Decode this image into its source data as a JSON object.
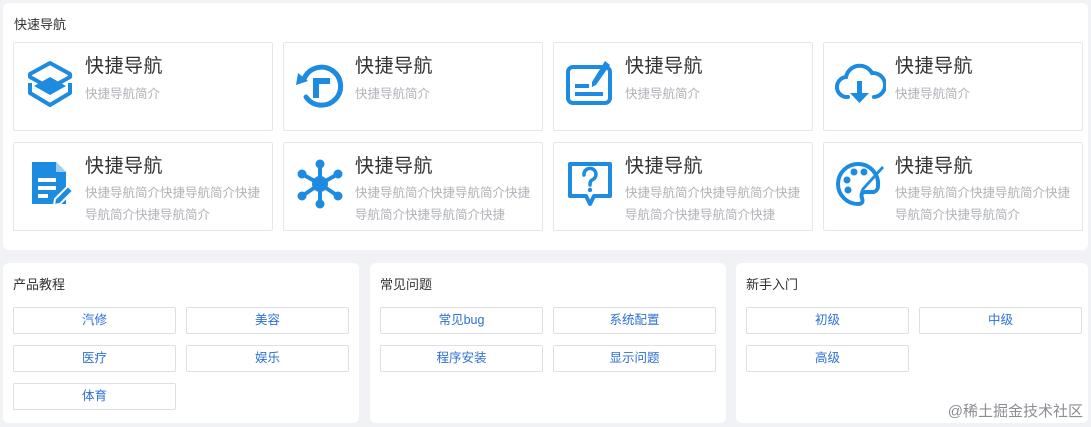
{
  "quick_nav": {
    "title": "快速导航",
    "cards": [
      {
        "title": "快捷导航",
        "desc": "快捷导航简介",
        "icon": "cube-layers-icon"
      },
      {
        "title": "快捷导航",
        "desc": "快捷导航简介",
        "icon": "refresh-t-icon"
      },
      {
        "title": "快捷导航",
        "desc": "快捷导航简介",
        "icon": "edit-board-icon"
      },
      {
        "title": "快捷导航",
        "desc": "快捷导航简介",
        "icon": "cloud-download-icon"
      },
      {
        "title": "快捷导航",
        "desc": "快捷导航简介快捷导航简介快捷导航简介快捷导航简介",
        "icon": "document-edit-icon"
      },
      {
        "title": "快捷导航",
        "desc": "快捷导航简介快捷导航简介快捷导航简介快捷导航简介快捷",
        "icon": "network-nodes-icon"
      },
      {
        "title": "快捷导航",
        "desc": "快捷导航简介快捷导航简介快捷导航简介快捷导航简介快捷",
        "icon": "question-bubble-icon"
      },
      {
        "title": "快捷导航",
        "desc": "快捷导航简介快捷导航简介快捷导航简介快捷导航简介",
        "icon": "palette-brush-icon"
      }
    ]
  },
  "tutorials": {
    "title": "产品教程",
    "tags": [
      "汽修",
      "美容",
      "医疗",
      "娱乐",
      "体育"
    ]
  },
  "faq": {
    "title": "常见问题",
    "tags": [
      "常见bug",
      "系统配置",
      "程序安装",
      "显示问题"
    ]
  },
  "beginner": {
    "title": "新手入门",
    "tags": [
      "初级",
      "中级",
      "高级"
    ]
  },
  "watermark": "@稀土掘金技术社区",
  "colors": {
    "accent": "#1d8ce0",
    "tag_text": "#2d6fd6"
  }
}
